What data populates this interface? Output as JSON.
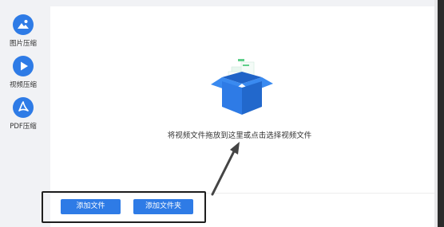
{
  "sidebar": {
    "items": [
      {
        "label": "图片压缩",
        "icon": "image-icon"
      },
      {
        "label": "视频压缩",
        "icon": "play-icon"
      },
      {
        "label": "PDF压缩",
        "icon": "pdf-icon"
      }
    ]
  },
  "main": {
    "drop_hint": "将视频文件拖放到这里或点击选择视频文件",
    "illustration": "open-box-icon"
  },
  "footer": {
    "add_file_label": "添加文件",
    "add_folder_label": "添加文件夹"
  },
  "colors": {
    "accent": "#2e7be6",
    "highlight_border": "#1e1e1e"
  }
}
